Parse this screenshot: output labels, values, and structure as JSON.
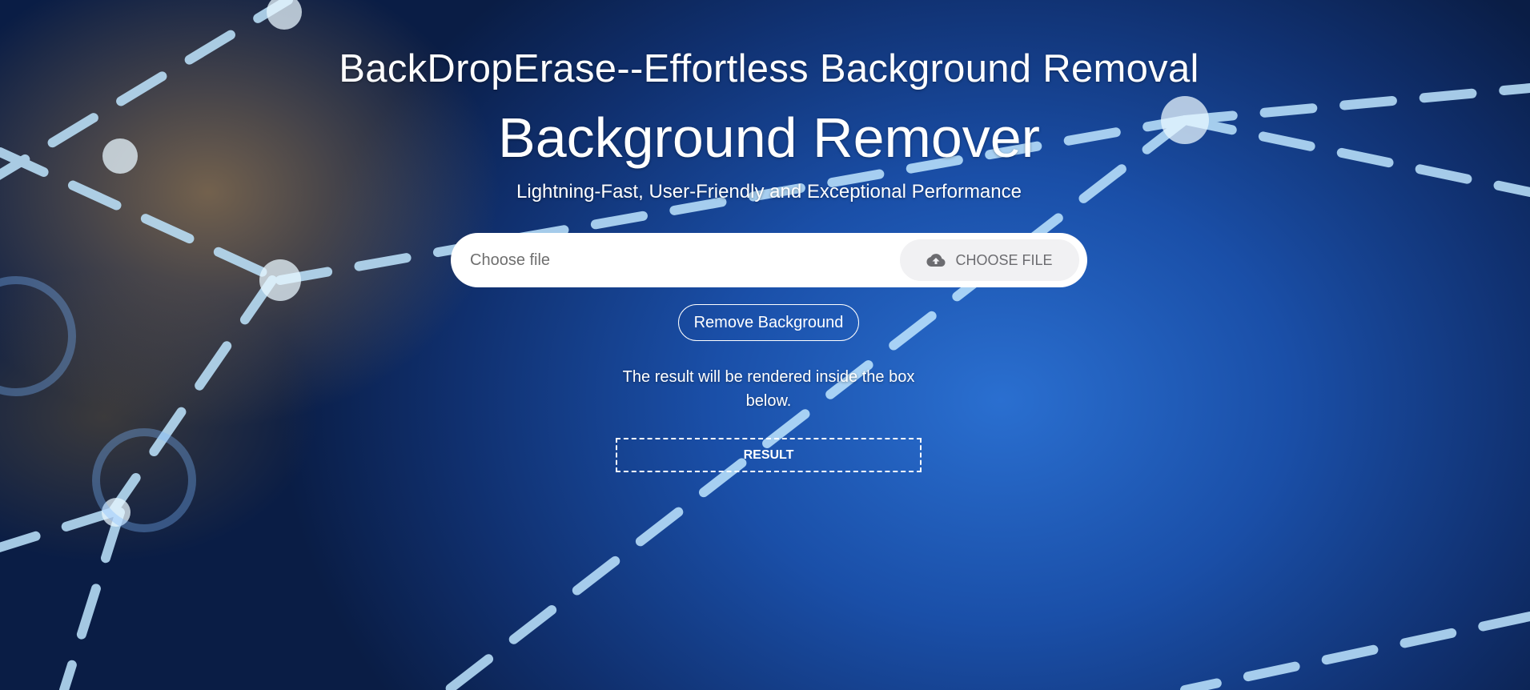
{
  "header": {
    "brand_title": "BackDropErase--Effortless Background Removal",
    "main_title": "Background Remover",
    "subtitle": "Lightning-Fast, User-Friendly and Exceptional Performance"
  },
  "upload": {
    "placeholder": "Choose file",
    "choose_button_label": "CHOOSE FILE",
    "choose_button_icon": "cloud-upload-icon"
  },
  "actions": {
    "remove_background_label": "Remove Background"
  },
  "result": {
    "note": "The result will be rendered inside the box below.",
    "box_label": "RESULT"
  },
  "colors": {
    "text": "#ffffff",
    "input_background": "#ffffff",
    "choose_button_background": "#f1f1f3",
    "choose_button_text": "#6c6c70",
    "placeholder_text": "#6f6f6f"
  }
}
